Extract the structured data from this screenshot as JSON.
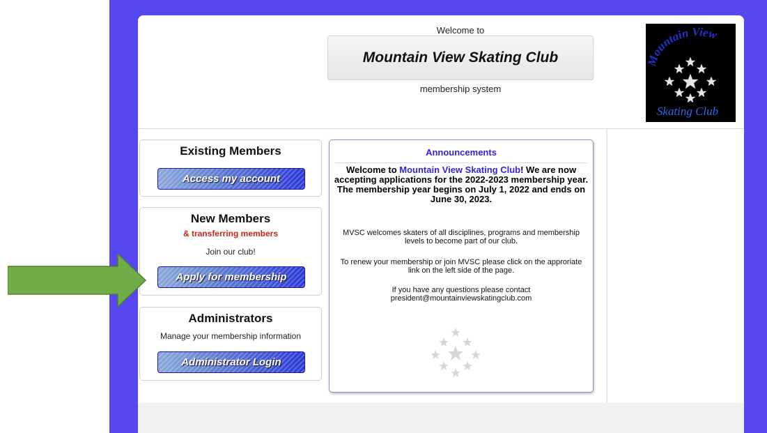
{
  "header": {
    "welcome_to": "Welcome to",
    "club_name": "Mountain View Skating Club",
    "subtitle": "membership system",
    "logo": {
      "text_top": "Mountain View",
      "text_bottom": "Skating Club",
      "colors": {
        "top": "#2233cc",
        "bottom": "#3366ee"
      }
    }
  },
  "sidebar": {
    "existing": {
      "heading": "Existing Members",
      "button": "Access my account"
    },
    "new_members": {
      "heading": "New Members",
      "subheading": "& transferring members",
      "note": "Join our club!",
      "button": "Apply for membership"
    },
    "admins": {
      "heading": "Administrators",
      "note": "Manage your membership information",
      "button": "Administrator Login"
    }
  },
  "announcements": {
    "title": "Announcements",
    "intro_before": "Welcome to ",
    "intro_club": "Mountain View Skating Club",
    "intro_after": "! We are now accepting applications for the 2022-2023 membership year. The membership year begins on July 1, 2022 and ends on June 30, 2023.",
    "p1": "MVSC welcomes skaters of all disciplines, programs and membership levels to become part of our club.",
    "p2": "To renew your membership or join MVSC please click on the approriate link on the left side of the page.",
    "p3_line1": "If you have any questions please contact",
    "p3_line2": "president@mountainviewskatingclub.com"
  },
  "colors": {
    "frame": "#5647f0",
    "accent_blue": "#3322dd",
    "accent_red": "#c8261b",
    "arrow_green": "#70ad47"
  }
}
